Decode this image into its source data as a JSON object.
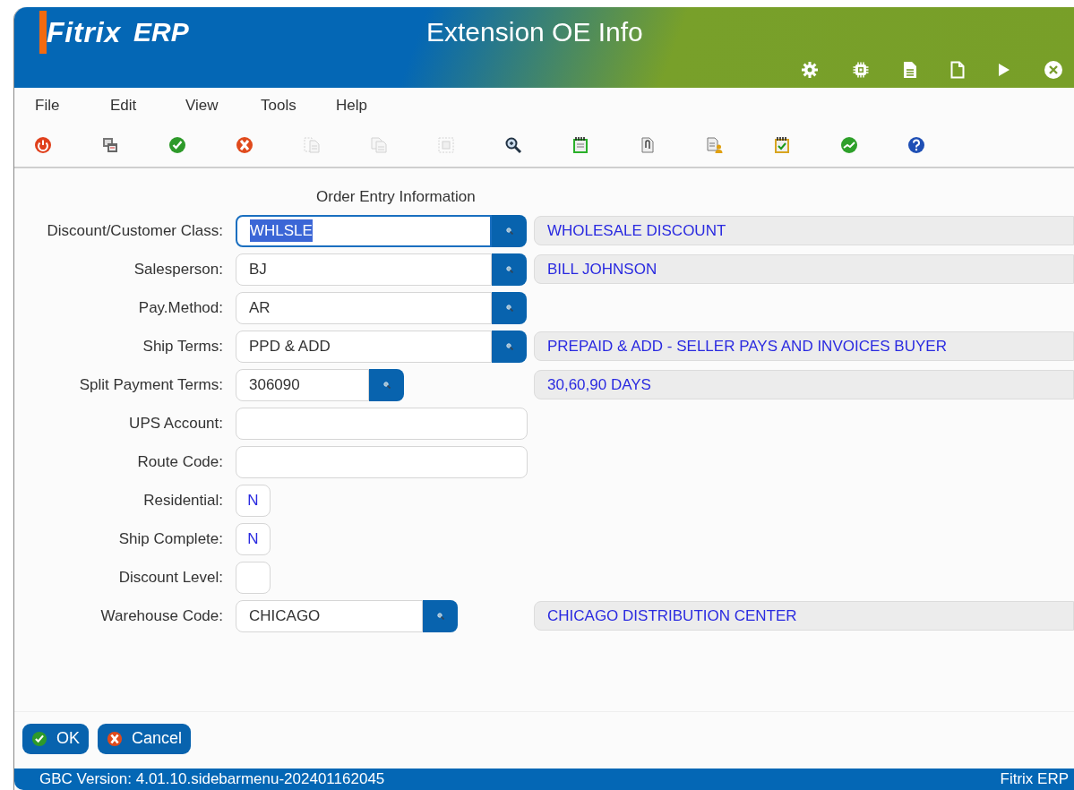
{
  "window": {
    "logo_brand": "Fitrix",
    "logo_suffix": "ERP",
    "title": "Extension OE Info"
  },
  "header_icons": [
    {
      "kind": "gear"
    },
    {
      "kind": "chip"
    },
    {
      "kind": "doc-lines"
    },
    {
      "kind": "doc"
    },
    {
      "kind": "play"
    },
    {
      "kind": "close"
    }
  ],
  "menu": [
    "File",
    "Edit",
    "View",
    "Tools",
    "Help"
  ],
  "toolbar": [
    {
      "kind": "power",
      "disabled": false
    },
    {
      "kind": "windows",
      "disabled": false
    },
    {
      "kind": "check",
      "disabled": false
    },
    {
      "kind": "cancel",
      "disabled": false
    },
    {
      "kind": "cut",
      "disabled": true
    },
    {
      "kind": "copy",
      "disabled": true
    },
    {
      "kind": "paste",
      "disabled": true
    },
    {
      "kind": "zoom",
      "disabled": false
    },
    {
      "kind": "notepad",
      "disabled": false
    },
    {
      "kind": "clip",
      "disabled": false
    },
    {
      "kind": "doc-person",
      "disabled": false
    },
    {
      "kind": "notepad-check",
      "disabled": false
    },
    {
      "kind": "chart",
      "disabled": false
    },
    {
      "kind": "help",
      "disabled": false
    }
  ],
  "form": {
    "title": "Order Entry Information",
    "fields": [
      {
        "label": "Discount/Customer Class:",
        "kind": "lookup",
        "value": "WHLSLE",
        "focused": true,
        "description": "WHOLESALE DISCOUNT"
      },
      {
        "label": "Salesperson:",
        "kind": "lookup",
        "value": "BJ",
        "focused": false,
        "description": "BILL JOHNSON"
      },
      {
        "label": "Pay.Method:",
        "kind": "lookup",
        "value": "AR",
        "focused": false
      },
      {
        "label": "Ship Terms:",
        "kind": "lookup",
        "value": "PPD & ADD",
        "focused": false,
        "description": "PREPAID & ADD - SELLER PAYS AND INVOICES BUYER"
      },
      {
        "label": "Split Payment Terms:",
        "kind": "shortlookup",
        "value": "306090",
        "focused": false,
        "description": "30,60,90 DAYS"
      },
      {
        "label": "UPS Account:",
        "kind": "text",
        "focused": false
      },
      {
        "label": "Route Code:",
        "kind": "text",
        "focused": false
      },
      {
        "label": "Residential:",
        "kind": "flag",
        "value": "N",
        "focused": false
      },
      {
        "label": "Ship Complete:",
        "kind": "flag",
        "value": "N",
        "focused": false
      },
      {
        "label": "Discount Level:",
        "kind": "flag",
        "focused": false
      },
      {
        "label": "Warehouse Code:",
        "kind": "midlookup",
        "value": "CHICAGO",
        "focused": false,
        "description": "CHICAGO DISTRIBUTION CENTER"
      }
    ]
  },
  "buttons": [
    {
      "kind": "ok",
      "label": "OK"
    },
    {
      "kind": "cancel",
      "label": "Cancel"
    }
  ],
  "status_bar": {
    "version": "GBC Version: 4.01.10.sidebarmenu-202401162045",
    "product": "Fitrix ERP"
  }
}
